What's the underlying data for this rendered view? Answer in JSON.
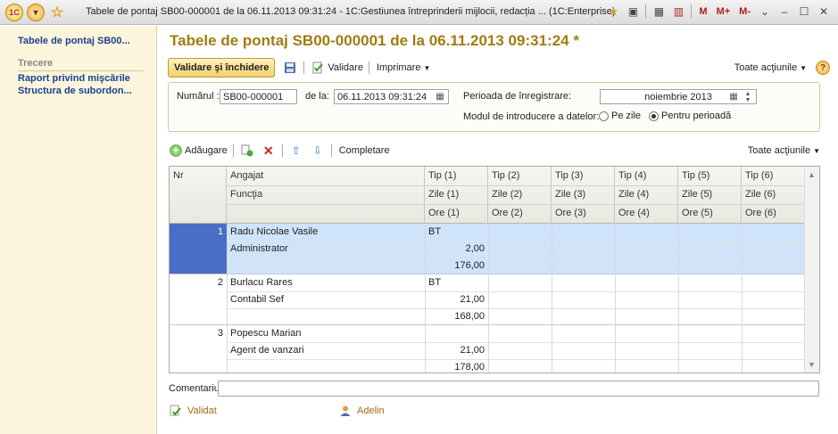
{
  "window": {
    "title": "Tabele de pontaj SB00-000001 de la 06.11.2013 09:31:24 - 1C:Gestiunea întreprinderii mijlocii, redacția ...  (1C:Enterprise)",
    "right_texts": [
      "M",
      "M+",
      "M-"
    ]
  },
  "sidebar": {
    "items": [
      {
        "label": "Tabele de pontaj SB00..."
      },
      {
        "label": "Trecere"
      },
      {
        "label": "Raport privind mişcările"
      },
      {
        "label": "Structura de subordon..."
      }
    ]
  },
  "main": {
    "title": "Tabele de pontaj SB00-000001 de la 06.11.2013 09:31:24 *",
    "toolbar": {
      "primary_label": "Validare şi închidere",
      "validate_label": "Validare",
      "print_label": "Imprimare",
      "all_actions_label": "Toate acţiunile"
    },
    "header": {
      "number_label": "Numărul :",
      "number_value": "SB00-000001",
      "date_label": "de la:",
      "date_value": "06.11.2013 09:31:24",
      "period_label": "Perioada de înregistrare:",
      "period_value": "noiembrie 2013",
      "mode_label": "Modul de introducere a datelor:",
      "mode_options": [
        "Pe zile",
        "Pentru perioadă"
      ],
      "mode_selected": "Pentru perioadă"
    },
    "table_toolbar": {
      "add_label": "Adăugare",
      "fill_label": "Completare",
      "all_actions_label": "Toate acţiunile"
    },
    "table": {
      "headers": {
        "nr": "Nr",
        "employee": "Angajat",
        "position": "Funcţia",
        "tip": [
          "Tip (1)",
          "Tip (2)",
          "Tip (3)",
          "Tip (4)",
          "Tip (5)",
          "Tip (6)"
        ],
        "zile": [
          "Zile (1)",
          "Zile (2)",
          "Zile (3)",
          "Zile (4)",
          "Zile (5)",
          "Zile (6)"
        ],
        "ore": [
          "Ore (1)",
          "Ore (2)",
          "Ore (3)",
          "Ore (4)",
          "Ore (5)",
          "Ore (6)"
        ]
      },
      "rows": [
        {
          "nr": "1",
          "employee": "Radu Nicolae Vasile",
          "position": "Administrator",
          "tip1": "BT",
          "zile1": "2,00",
          "ore1": "176,00",
          "selected": true
        },
        {
          "nr": "2",
          "employee": "Burlacu Rares",
          "position": "Contabil Sef",
          "tip1": "BT",
          "zile1": "21,00",
          "ore1": "168,00",
          "selected": false
        },
        {
          "nr": "3",
          "employee": "Popescu Marian",
          "position": "Agent de vanzari",
          "tip1": "",
          "zile1": "21,00",
          "ore1": "178,00",
          "selected": false
        }
      ]
    },
    "comment_label": "Comentariu:",
    "comment_value": "",
    "status_validated": "Validat",
    "status_user": "Adelin"
  },
  "colors": {
    "title": "#a17c10",
    "sidebar_bg": "#fbf5dc",
    "selected_row": "#cfe3fa",
    "selected_nr": "#4a6ec3"
  }
}
